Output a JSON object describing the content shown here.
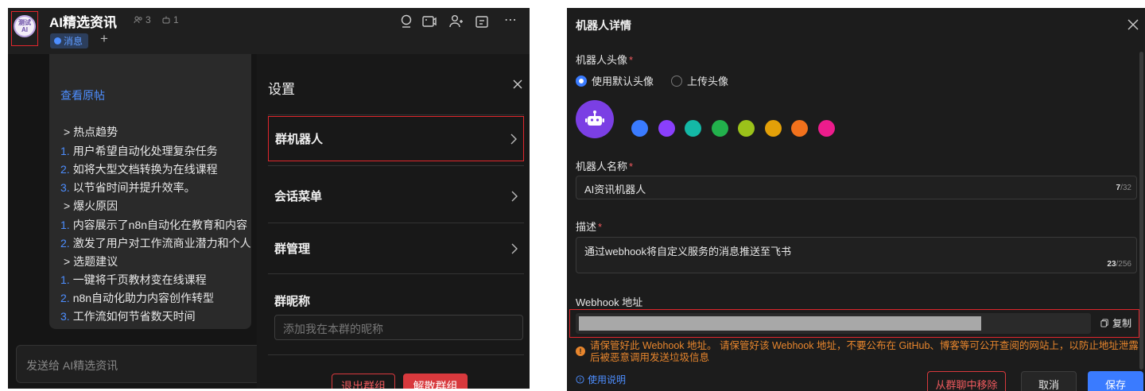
{
  "left": {
    "avatar_text_line1": "测试",
    "avatar_text_line2": "AI",
    "group_name": "AI精选资讯",
    "member_count": "3",
    "bot_count": "1",
    "tabs": [
      {
        "label": "消息"
      }
    ],
    "add_tab_label": "+",
    "message": {
      "link": "查看原帖",
      "lines": [
        {
          "num": "",
          "text": "> 热点趋势"
        },
        {
          "num": "1.",
          "text": "用户希望自动化处理复杂任务"
        },
        {
          "num": "2.",
          "text": "如将大型文档转换为在线课程"
        },
        {
          "num": "3.",
          "text": "以节省时间并提升效率。"
        },
        {
          "num": "",
          "text": "> 爆火原因"
        },
        {
          "num": "1.",
          "text": "内容展示了n8n自动化在教育和内容"
        },
        {
          "num": "2.",
          "text": "激发了用户对工作流商业潜力和个人"
        },
        {
          "num": "",
          "text": "> 选题建议"
        },
        {
          "num": "1.",
          "text": "一键将千页教材变在线课程"
        },
        {
          "num": "2.",
          "text": "n8n自动化助力内容创作转型"
        },
        {
          "num": "3.",
          "text": "工作流如何节省数天时间"
        }
      ]
    },
    "input_placeholder": "发送给 AI精选资讯",
    "settings": {
      "title": "设置",
      "rows": [
        "群机器人",
        "会话菜单",
        "群管理"
      ],
      "nickname_label": "群昵称",
      "nickname_placeholder": "添加我在本群的昵称",
      "exit_label": "退出群组",
      "dismiss_label": "解散群组"
    }
  },
  "right": {
    "title": "机器人详情",
    "avatar_label": "机器人头像",
    "radio_default": "使用默认头像",
    "radio_upload": "上传头像",
    "swatches": [
      "#3a7bff",
      "#8a3ffc",
      "#14b8a6",
      "#22b14c",
      "#9bc21a",
      "#e3a008",
      "#f2711c",
      "#ec1c8c"
    ],
    "name_label": "机器人名称",
    "name_value": "AI资讯机器人",
    "name_count": "7",
    "name_max": "/32",
    "desc_label": "描述",
    "desc_value": "通过webhook将自定义服务的消息推送至飞书",
    "desc_count": "23",
    "desc_max": "/256",
    "webhook_label": "Webhook 地址",
    "copy_label": "复制",
    "warning": "请保管好此 Webhook 地址。 请保管好该 Webhook 地址，不要公布在 GitHub、博客等可公开查阅的网站上，以防止地址泄露后被恶意调用发送垃圾信息",
    "help_label": "使用说明",
    "remove_label": "从群聊中移除",
    "cancel_label": "取消",
    "save_label": "保存"
  }
}
